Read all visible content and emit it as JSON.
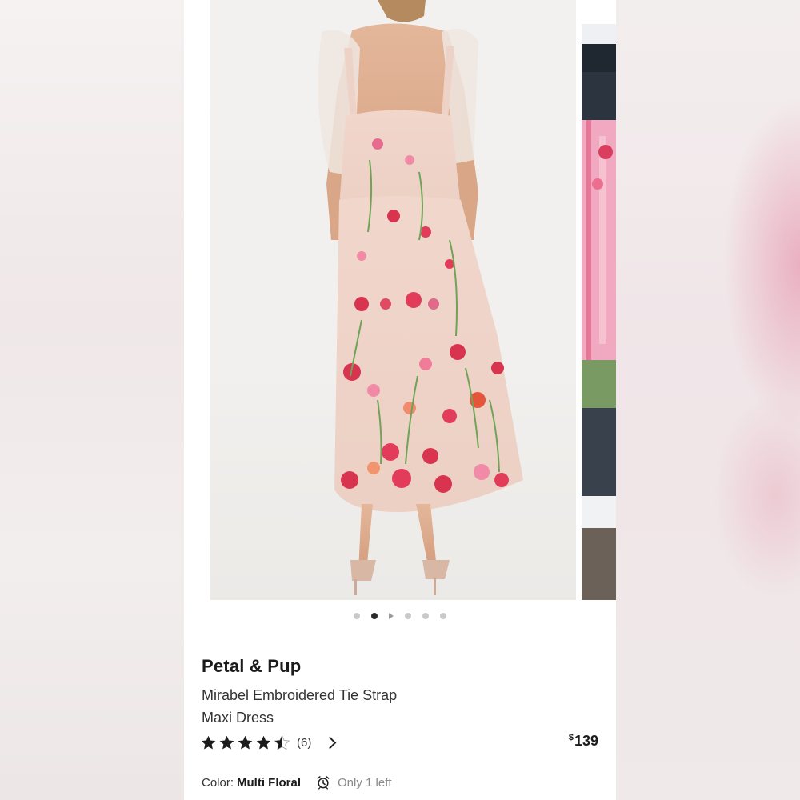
{
  "product": {
    "brand": "Petal & Pup",
    "name_line1": "Mirabel Embroidered Tie Strap",
    "name_line2": "Maxi Dress",
    "rating": 4.5,
    "review_count": "(6)",
    "price_symbol": "$",
    "price": "139",
    "color_label": "Color:",
    "color_value": "Multi Floral",
    "stock": "Only 1 left"
  },
  "carousel": {
    "total_dots": 6,
    "active_index": 1,
    "video_index": 2
  },
  "icons": {
    "rating_arrow": "chevron-right-icon",
    "stock_icon": "alarm-clock-icon"
  },
  "colors": {
    "star": "#1b1b1b",
    "dot_active": "#2a2a2a",
    "dot_inactive": "#c9c9c9"
  }
}
